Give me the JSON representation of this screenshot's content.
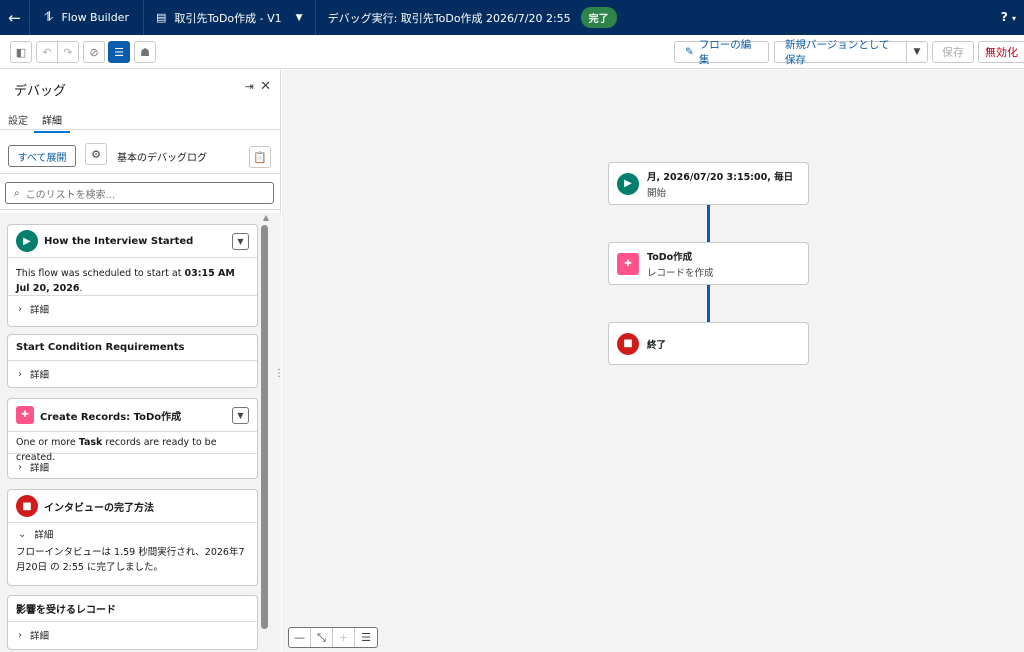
{
  "header": {
    "app_name": "Flow Builder",
    "flow_name": "取引先ToDo作成 - V1",
    "debug_title": "デバッグ実行: 取引先ToDo作成 2026/7/20 2:55",
    "status_badge": "完了",
    "help_label": "?"
  },
  "toolbar": {
    "edit_flow": "フローの編集",
    "save_new_version": "新規バージョンとして保存",
    "save": "保存",
    "deactivate": "無効化"
  },
  "debug_panel": {
    "title": "デバッグ",
    "tabs": [
      {
        "label": "設定"
      },
      {
        "label": "詳細"
      }
    ],
    "expand_all": "すべて展開",
    "log_label": "基本のデバッグログ",
    "search_placeholder": "このリストを検索...",
    "cards": [
      {
        "title": "How the Interview Started",
        "body_pre": "This flow was scheduled to start at ",
        "body_bold": "03:15 AM Jul 20, 2026",
        "body_post": ".",
        "foot": "詳細"
      },
      {
        "title": "Start Condition Requirements",
        "foot": "詳細"
      },
      {
        "title": "Create Records: ToDo作成",
        "body_pre": "One or more ",
        "body_bold": "Task",
        "body_post": " records are ready to be created.",
        "foot": "詳細"
      },
      {
        "title": "インタビューの完了方法",
        "foot": "詳細",
        "body_text": "フローインタビューは 1.59 秒間実行され、2026年7月20日 の 2:55 に完了しました。"
      },
      {
        "title": "影響を受けるレコード",
        "foot": "詳細"
      }
    ]
  },
  "canvas": {
    "nodes": [
      {
        "title": "月, 2026/07/20 3:15:00, 毎日",
        "subtitle": "開始"
      },
      {
        "title": "ToDo作成",
        "subtitle": "レコードを作成"
      },
      {
        "title": "終了",
        "subtitle": ""
      }
    ]
  },
  "colors": {
    "header_bg": "#032d60",
    "accent": "#0b5cab",
    "start_icon": "#027e6c",
    "record_icon": "#ff538a",
    "end_icon": "#d11c1c",
    "badge": "#2e844a"
  }
}
